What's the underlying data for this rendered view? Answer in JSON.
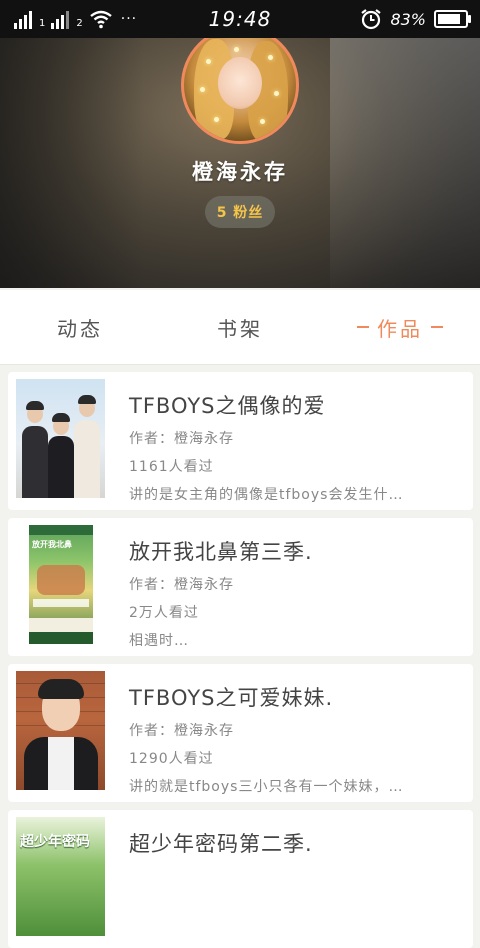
{
  "status_bar": {
    "sim1": "1",
    "sim2": "2",
    "more": "···",
    "time": "19:48",
    "battery_percent": "83%",
    "battery_level": 0.83,
    "icons": [
      "signal-icon",
      "wifi-icon",
      "alarm-icon",
      "battery-icon"
    ]
  },
  "profile": {
    "username": "橙海永存",
    "fans_label": "5 粉丝"
  },
  "tabs": [
    {
      "label": "动态",
      "active": false
    },
    {
      "label": "书架",
      "active": false
    },
    {
      "label": "作品",
      "active": true
    }
  ],
  "works": [
    {
      "title": "TFBOYS之偶像的爱",
      "author": "作者：橙海永存",
      "views": "1161人看过",
      "summary": "讲的是女主角的偶像是tfboys会发生什…"
    },
    {
      "title": "放开我北鼻第三季.",
      "author": "作者：橙海永存",
      "views": "2万人看过",
      "summary": "相遇时…"
    },
    {
      "title": "TFBOYS之可爱妹妹.",
      "author": "作者：橙海永存",
      "views": "1290人看过",
      "summary": "讲的就是tfboys三小只各有一个妹妹，…"
    },
    {
      "title": "超少年密码第二季.",
      "author": "",
      "views": "",
      "summary": ""
    }
  ],
  "covers": {
    "poster_text": "放开我北鼻",
    "last_cover_text": "超少年密码"
  },
  "colors": {
    "accent": "#f08a5d",
    "fans_text": "#f5c54a",
    "status_bar": "#111111"
  }
}
